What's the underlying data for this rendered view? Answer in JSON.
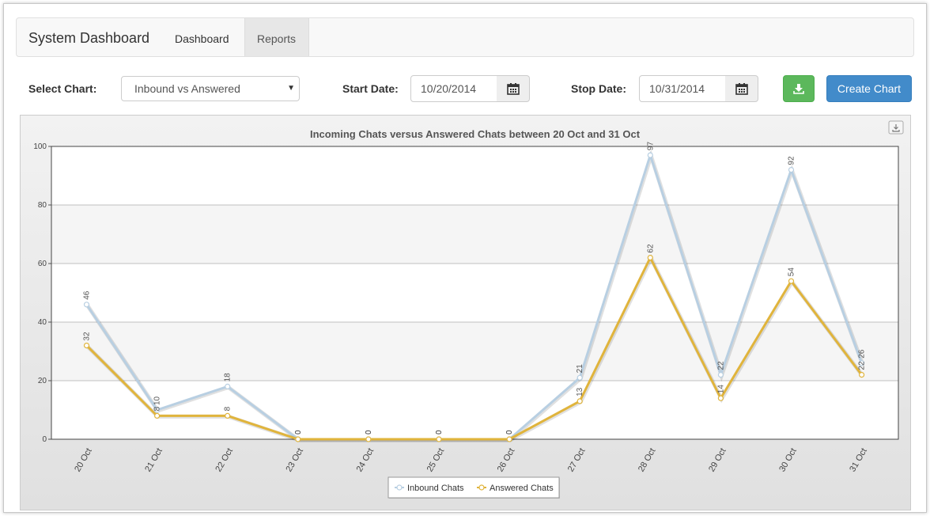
{
  "navbar": {
    "brand": "System Dashboard",
    "links": [
      {
        "label": "Dashboard"
      },
      {
        "label": "Reports"
      }
    ]
  },
  "toolbar": {
    "select_label": "Select Chart:",
    "select_value": "Inbound vs Answered",
    "start_label": "Start Date:",
    "start_value": "10/20/2014",
    "stop_label": "Stop Date:",
    "stop_value": "10/31/2014",
    "create_label": "Create Chart",
    "download_icon": "download-icon",
    "calendar_icon": "calendar-icon"
  },
  "colors": {
    "inbound": "#b8cfe2",
    "answered": "#e0b43c",
    "accent": "#428bca",
    "success": "#5cb85c"
  },
  "chart_data": {
    "type": "line",
    "title": "Incoming Chats versus Answered Chats between 20 Oct and 31 Oct",
    "categories": [
      "20 Oct",
      "21 Oct",
      "22 Oct",
      "23 Oct",
      "24 Oct",
      "25 Oct",
      "26 Oct",
      "27 Oct",
      "28 Oct",
      "29 Oct",
      "30 Oct",
      "31 Oct"
    ],
    "series": [
      {
        "name": "Inbound Chats",
        "values": [
          46,
          10,
          18,
          0,
          0,
          0,
          0,
          21,
          97,
          22,
          92,
          26
        ]
      },
      {
        "name": "Answered Chats",
        "values": [
          32,
          8,
          8,
          0,
          0,
          0,
          0,
          13,
          62,
          14,
          54,
          22
        ]
      }
    ],
    "yticks": [
      "0",
      "20",
      "40",
      "60",
      "80",
      "100"
    ],
    "ylim": [
      0,
      100
    ],
    "grid": true,
    "legend": "bottom-center"
  }
}
